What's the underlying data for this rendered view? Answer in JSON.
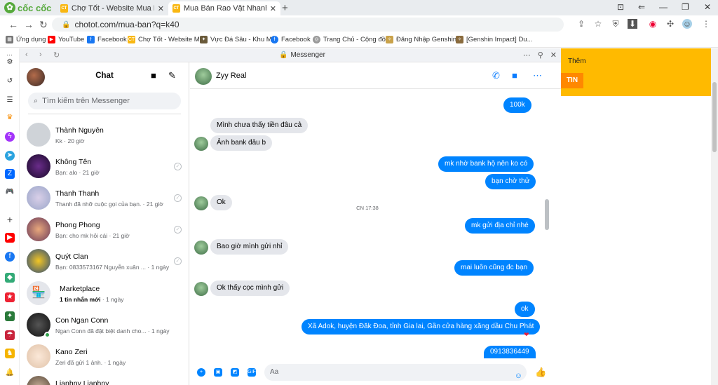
{
  "browser": {
    "brand": "cốc cốc",
    "tabs": [
      {
        "label": "Chợ Tốt - Website Mua Bán...",
        "active": false
      },
      {
        "label": "Mua Bán Rao Vặt Nhanh Chó...",
        "active": true
      }
    ],
    "url": "chotot.com/mua-ban?q=k40",
    "bookmarks": [
      "Ứng dụng",
      "YouTube",
      "Facebook",
      "Chợ Tốt - Website M...",
      "Vực Đá Sâu - Khu M...",
      "Facebook",
      "Trang Chủ - Cộng đồ...",
      "Đăng Nhập Genshin...",
      "[Genshin Impact] Du..."
    ]
  },
  "page": {
    "them_label": "Thêm",
    "tin_label": "TIN"
  },
  "messenger": {
    "title": "Messenger",
    "chat_title": "Chat",
    "search_placeholder": "Tìm kiếm trên Messenger",
    "conversations": [
      {
        "name": "Thành Nguyên",
        "sub": "Kk · 20 giờ"
      },
      {
        "name": "Không Tên",
        "sub": "Bạn: alo · 21 giờ"
      },
      {
        "name": "Thanh Thanh",
        "sub": "Thanh đã nhỡ cuộc gọi của bạn. · 21 giờ"
      },
      {
        "name": "Phong Phong",
        "sub": "Bạn: cho mk hỏi cái · 21 giờ"
      },
      {
        "name": "Quýt Clan",
        "sub": "Bạn: 0833573167 Nguyễn xuân ... · 1 ngày"
      },
      {
        "name": "Marketplace",
        "sub_bold": "1 tin nhắn mới",
        "sub": " · 1 ngày"
      },
      {
        "name": "Con Ngan Conn",
        "sub": "Ngan Conn đã đặt biệt danh cho... · 1 ngày"
      },
      {
        "name": "Kano Zeri",
        "sub": "Zeri đã gửi 1 ảnh. · 1 ngày"
      },
      {
        "name": "Lianhny Lianhny",
        "sub": ""
      }
    ],
    "active_chat": {
      "name": "Zyy Real",
      "messages": [
        {
          "dir": "out",
          "text": "100k"
        },
        {
          "dir": "in",
          "text": "Mình chưa thấy tiền đâu cả"
        },
        {
          "dir": "in",
          "text": "Ảnh bank đâu b"
        },
        {
          "dir": "out",
          "text": "mk nhờ bank hộ nên ko có"
        },
        {
          "dir": "out",
          "text": "bạn chờ thử"
        },
        {
          "dir": "in",
          "text": "Ok"
        },
        {
          "dir": "out",
          "text": "mk gửi địa chỉ nhé"
        },
        {
          "dir": "in",
          "text": "Bao giờ mình gửi nhỉ"
        },
        {
          "dir": "out",
          "text": "mai luôn cũng đc bạn"
        },
        {
          "dir": "in",
          "text": "Ok thấy cọc mình gửi"
        },
        {
          "dir": "out",
          "text": "ok"
        },
        {
          "dir": "out",
          "text": "Xã Adok, huyện Đăk Đoa, tỉnh Gia lai, Gần cửa hàng xăng dầu Chu Phát"
        },
        {
          "dir": "out",
          "text": "0913836449"
        }
      ],
      "timestamp": "CN 17:38",
      "composer_placeholder": "Aa"
    }
  },
  "colors": {
    "accent": "#0084ff",
    "brand_green": "#56a93c",
    "chotot_yellow": "#ffba00"
  }
}
